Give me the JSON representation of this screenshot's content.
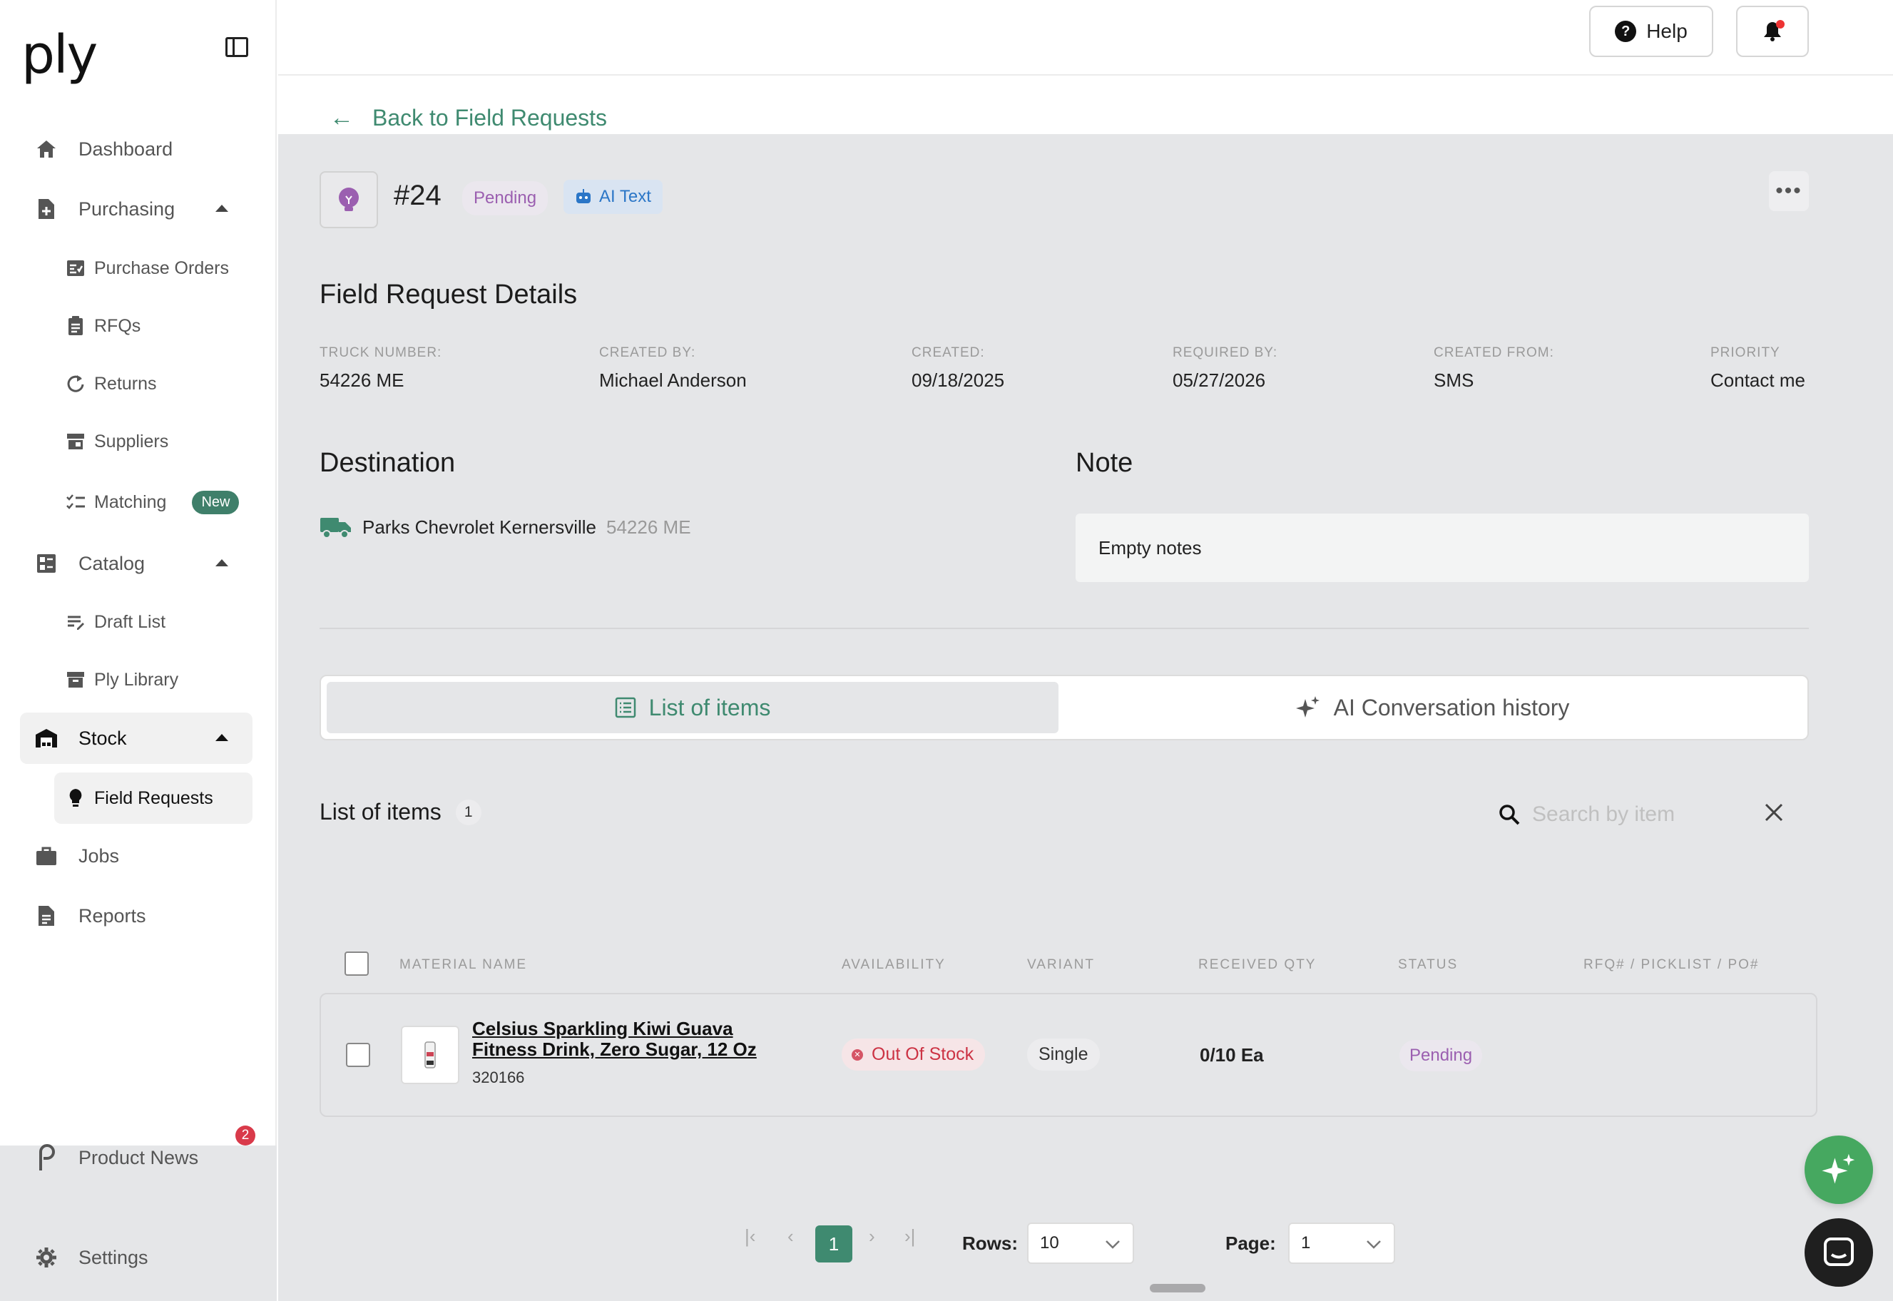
{
  "brand": {
    "logo_text": "ply"
  },
  "sidebar": {
    "items": [
      {
        "label": "Dashboard",
        "icon": "home-icon"
      },
      {
        "label": "Purchasing",
        "icon": "purchase-doc-icon"
      },
      {
        "label": "Purchase Orders",
        "icon": "order-list-icon"
      },
      {
        "label": "RFQs",
        "icon": "clipboard-icon"
      },
      {
        "label": "Returns",
        "icon": "refresh-icon"
      },
      {
        "label": "Suppliers",
        "icon": "store-icon"
      },
      {
        "label": "Matching",
        "icon": "checklist-icon",
        "badge": "New"
      },
      {
        "label": "Catalog",
        "icon": "catalog-icon"
      },
      {
        "label": "Draft List",
        "icon": "draft-list-icon"
      },
      {
        "label": "Ply Library",
        "icon": "archive-icon"
      },
      {
        "label": "Stock",
        "icon": "warehouse-icon"
      },
      {
        "label": "Field Requests",
        "icon": "lightbulb-icon"
      },
      {
        "label": "Jobs",
        "icon": "briefcase-icon"
      },
      {
        "label": "Reports",
        "icon": "report-icon"
      },
      {
        "label": "Product News",
        "icon": "ply-p-icon",
        "notification_count": "2"
      },
      {
        "label": "Settings",
        "icon": "gear-icon"
      }
    ]
  },
  "topbar": {
    "help_label": "Help"
  },
  "back_link": "Back to Field Requests",
  "request": {
    "number": "#24",
    "status": "Pending",
    "source_tag": "AI Text"
  },
  "details": {
    "title": "Field Request Details",
    "fields": [
      {
        "label": "TRUCK NUMBER:",
        "value": "54226 ME"
      },
      {
        "label": "CREATED BY:",
        "value": "Michael Anderson"
      },
      {
        "label": "CREATED:",
        "value": "09/18/2025"
      },
      {
        "label": "REQUIRED BY:",
        "value": "05/27/2026"
      },
      {
        "label": "CREATED FROM:",
        "value": "SMS"
      },
      {
        "label": "PRIORITY",
        "value": "Contact me"
      }
    ]
  },
  "destination": {
    "title": "Destination",
    "name": "Parks Chevrolet Kernersville",
    "code": "54226 ME"
  },
  "note": {
    "title": "Note",
    "text": "Empty notes"
  },
  "tabs": [
    {
      "label": "List of items"
    },
    {
      "label": "AI Conversation history"
    }
  ],
  "items_section": {
    "title": "List of items",
    "count": "1",
    "search_placeholder": "Search by item"
  },
  "table": {
    "headers": [
      "MATERIAL NAME",
      "AVAILABILITY",
      "VARIANT",
      "RECEIVED QTY",
      "STATUS",
      "RFQ# / PICKLIST / PO#"
    ],
    "rows": [
      {
        "name": "Celsius Sparkling Kiwi Guava Fitness Drink, Zero Sugar, 12 Oz",
        "code": "320166",
        "availability": "Out Of Stock",
        "variant": "Single",
        "received_qty": "0/10 Ea",
        "status": "Pending",
        "reference": ""
      }
    ]
  },
  "pagination": {
    "current_page": "1",
    "rows_label": "Rows:",
    "rows_value": "10",
    "page_label": "Page:",
    "page_value": "1"
  },
  "colors": {
    "accent": "#3f8a70",
    "pending": "#9b5fb0",
    "out_of_stock": "#cc3344",
    "ai_tag": "#2b76c7"
  }
}
